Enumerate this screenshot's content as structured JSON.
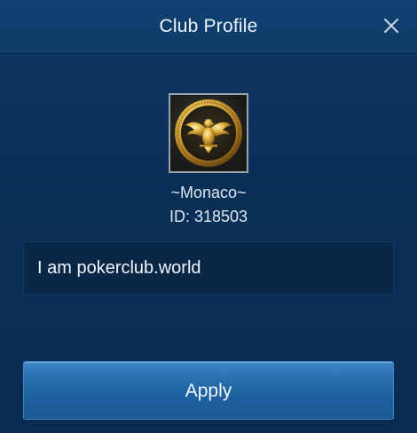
{
  "dialog": {
    "title": "Club Profile",
    "close_icon": "close-icon"
  },
  "club": {
    "avatar_icon": "eagle-emblem-icon",
    "name": "~Monaco~",
    "id_text": "ID: 318503",
    "description": "I am pokerclub.world"
  },
  "actions": {
    "apply_label": "Apply"
  },
  "colors": {
    "background": "#0a2f57",
    "header": "#0e3b68",
    "button": "#2a6faf",
    "text": "#dfe8f2"
  }
}
